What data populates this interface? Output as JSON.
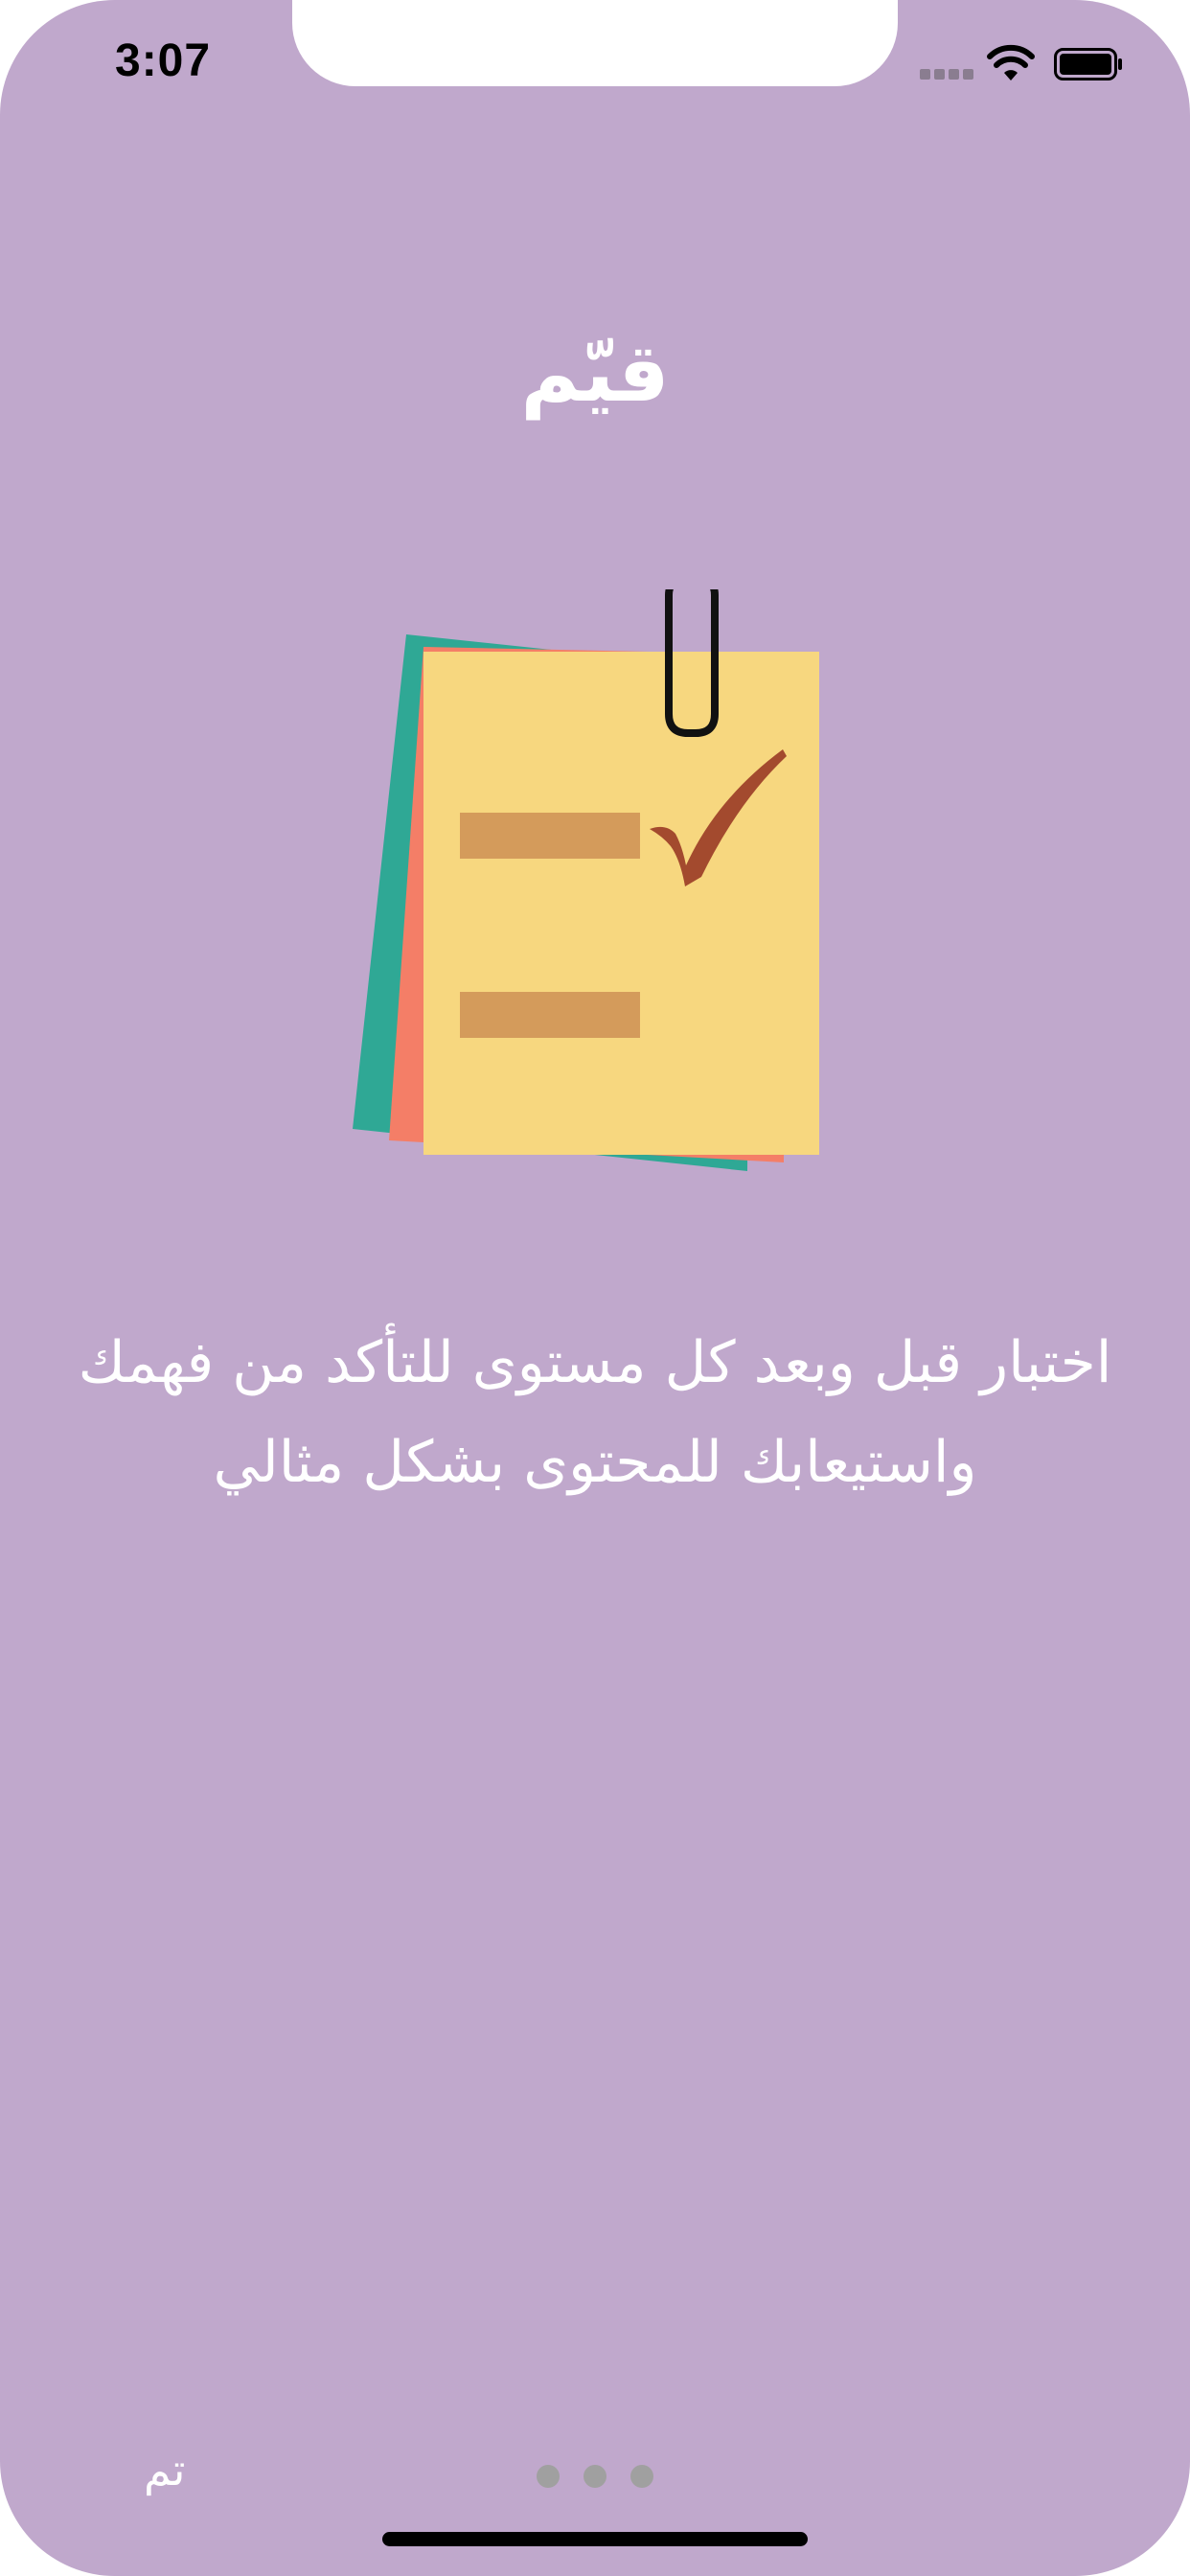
{
  "status_bar": {
    "time": "3:07"
  },
  "onboarding": {
    "title": "قيّم",
    "description_line1": "اختبار قبل وبعد كل مستوى للتأكد من فهمك",
    "description_line2": "واستيعابك للمحتوى بشكل مثالي",
    "illustration_icon": "checklist-notes-with-paperclip-icon",
    "done_label": "تم",
    "page_count": 3
  },
  "colors": {
    "background": "#c0a8cc",
    "text": "#ffffff",
    "page_dot": "#a0a0a0",
    "note_yellow": "#f7d77f",
    "note_orange": "#f47e67",
    "note_teal": "#2fa895",
    "bar": "#d49b5b",
    "check": "#a34a2e"
  }
}
